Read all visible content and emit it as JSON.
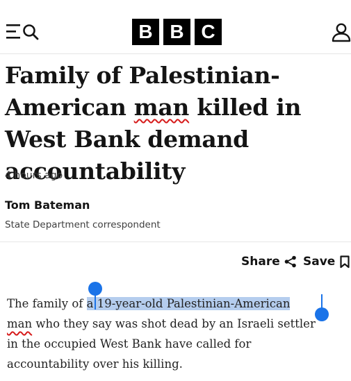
{
  "header": {
    "menu_icon": "hamburger-menu-icon",
    "search_icon": "search-icon",
    "logo_letters": [
      "B",
      "B",
      "C"
    ],
    "account_icon": "user-account-icon"
  },
  "article": {
    "headline_part1": "Family of Palestinian-American ",
    "headline_flagged": "man",
    "headline_part2": " killed in West Bank demand accountability",
    "timestamp": "4 hours ago",
    "author": "Tom Bateman",
    "author_role": "State Department correspondent",
    "share_label": "Share",
    "share_icon": "share-icon",
    "save_label": "Save",
    "save_icon": "bookmark-icon",
    "body_line1_before": "The family of ",
    "body_line1_selected": "a 19-year-old Palestinian-American",
    "body_line2_flagged": "man",
    "body_line2_rest": " who they say was shot dead by an Israeli settler",
    "body_line3": "in the occupied West Bank have called for",
    "body_line4": "accountability over his killing."
  },
  "colors": {
    "spellcheck_underline": "#d61a1a",
    "selection_highlight": "#b5cdee",
    "selection_handle": "#1a73e8",
    "logo_block": "#000000"
  }
}
